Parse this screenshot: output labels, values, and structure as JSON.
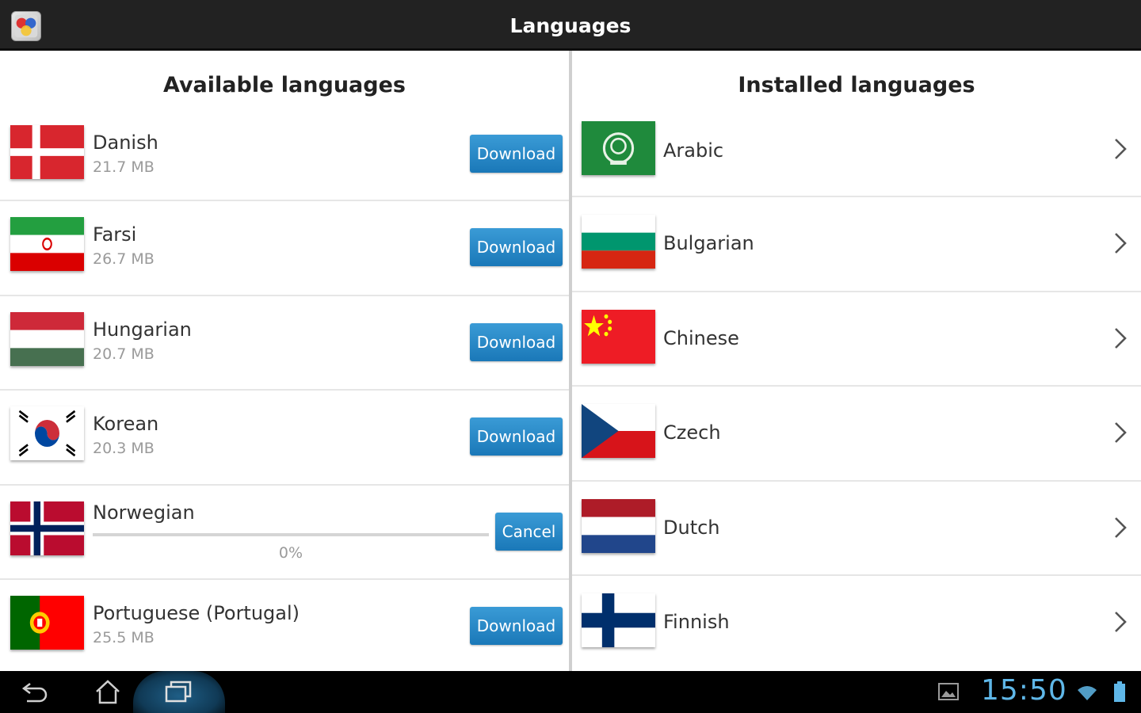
{
  "title": "Languages",
  "available": {
    "heading": "Available languages",
    "download_label": "Download",
    "cancel_label": "Cancel",
    "items": [
      {
        "name": "Danish",
        "size": "21.7 MB"
      },
      {
        "name": "Farsi",
        "size": "26.7 MB"
      },
      {
        "name": "Hungarian",
        "size": "20.7 MB"
      },
      {
        "name": "Korean",
        "size": "20.3 MB"
      },
      {
        "name": "Norwegian",
        "progress_label": "0%",
        "progress": 0
      },
      {
        "name": "Portuguese (Portugal)",
        "size": "25.5 MB"
      }
    ]
  },
  "installed": {
    "heading": "Installed languages",
    "items": [
      {
        "name": "Arabic"
      },
      {
        "name": "Bulgarian"
      },
      {
        "name": "Chinese"
      },
      {
        "name": "Czech"
      },
      {
        "name": "Dutch"
      },
      {
        "name": "Finnish"
      }
    ]
  },
  "statusbar": {
    "clock": "15:50"
  },
  "colors": {
    "accent": "#1a78b8",
    "clock": "#5fb7e8",
    "titlebar": "#222222"
  }
}
